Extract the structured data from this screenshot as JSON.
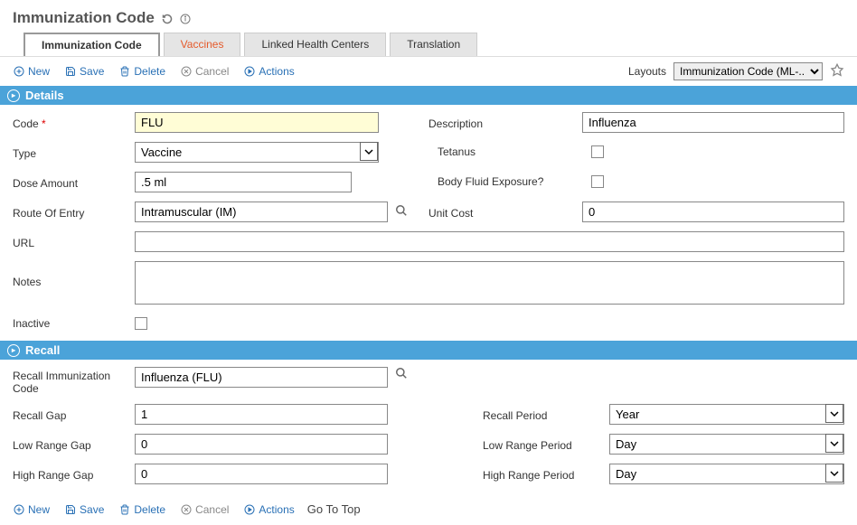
{
  "header": {
    "title": "Immunization Code"
  },
  "tabs": [
    {
      "label": "Immunization Code",
      "active": true,
      "highlight": false
    },
    {
      "label": "Vaccines",
      "active": false,
      "highlight": true
    },
    {
      "label": "Linked Health Centers",
      "active": false,
      "highlight": false
    },
    {
      "label": "Translation",
      "active": false,
      "highlight": false
    }
  ],
  "toolbar": {
    "new": "New",
    "save": "Save",
    "delete": "Delete",
    "cancel": "Cancel",
    "actions": "Actions",
    "layouts_label": "Layouts",
    "layout_value": "Immunization Code (ML-..."
  },
  "sections": {
    "details": "Details",
    "recall": "Recall"
  },
  "fields": {
    "code": {
      "label": "Code",
      "value": "FLU"
    },
    "description": {
      "label": "Description",
      "value": "Influenza"
    },
    "type": {
      "label": "Type",
      "value": "Vaccine"
    },
    "tetanus": {
      "label": "Tetanus",
      "checked": false
    },
    "dose_amount": {
      "label": "Dose Amount",
      "value": ".5 ml"
    },
    "body_fluid": {
      "label": "Body Fluid Exposure?",
      "checked": false
    },
    "route": {
      "label": "Route Of Entry",
      "value": "Intramuscular (IM)"
    },
    "unit_cost": {
      "label": "Unit Cost",
      "value": "0"
    },
    "url": {
      "label": "URL",
      "value": ""
    },
    "notes": {
      "label": "Notes",
      "value": ""
    },
    "inactive": {
      "label": "Inactive",
      "checked": false
    },
    "recall_code": {
      "label": "Recall Immunization Code",
      "value": "Influenza (FLU)"
    },
    "recall_gap": {
      "label": "Recall Gap",
      "value": "1"
    },
    "recall_period": {
      "label": "Recall Period",
      "value": "Year"
    },
    "low_gap": {
      "label": "Low Range Gap",
      "value": "0"
    },
    "low_period": {
      "label": "Low Range Period",
      "value": "Day"
    },
    "high_gap": {
      "label": "High Range Gap",
      "value": "0"
    },
    "high_period": {
      "label": "High Range Period",
      "value": "Day"
    }
  },
  "footer": {
    "go_top": "Go To Top"
  }
}
